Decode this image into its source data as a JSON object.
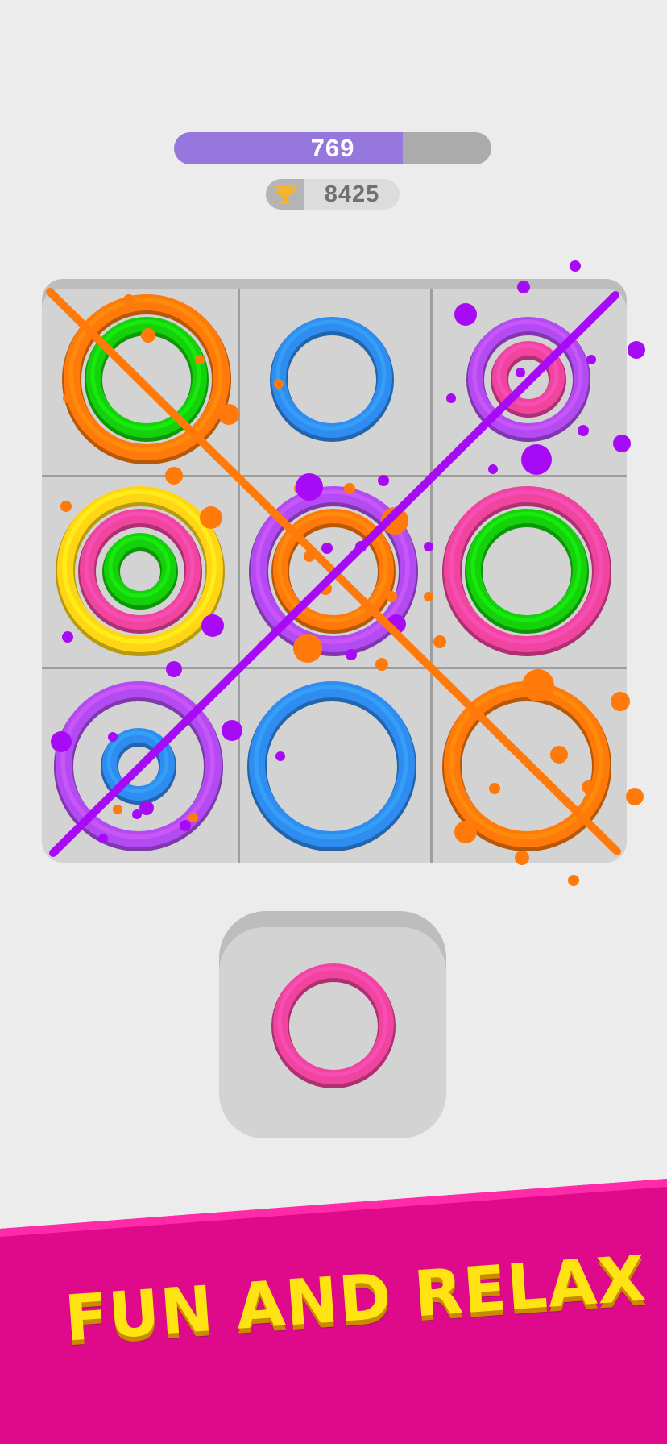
{
  "hud": {
    "score": "769",
    "score_progress": 0.72,
    "best_score": "8425"
  },
  "icons": {
    "best": "trophy-icon"
  },
  "colors": {
    "orange": "#ff7a0a",
    "green": "#14d10c",
    "blue": "#2f8cf0",
    "purple": "#b24cf2",
    "pink": "#f0449e",
    "yellow": "#ffd616",
    "splat_purple": "#a70bf5",
    "banner": "#de0a8b",
    "banner_text": "#ffe312"
  },
  "board": {
    "cells": [
      {
        "rings": [
          {
            "size": "large",
            "color": "orange"
          },
          {
            "size": "medium",
            "color": "green"
          }
        ]
      },
      {
        "rings": [
          {
            "size": "medium",
            "color": "blue"
          }
        ]
      },
      {
        "rings": [
          {
            "size": "medium",
            "color": "purple"
          },
          {
            "size": "small",
            "color": "pink"
          }
        ]
      },
      {
        "rings": [
          {
            "size": "large",
            "color": "yellow"
          },
          {
            "size": "medium",
            "color": "pink"
          },
          {
            "size": "small",
            "color": "green"
          }
        ]
      },
      {
        "rings": [
          {
            "size": "large",
            "color": "purple"
          },
          {
            "size": "medium",
            "color": "orange"
          }
        ]
      },
      {
        "rings": [
          {
            "size": "large",
            "color": "pink"
          },
          {
            "size": "medium",
            "color": "green"
          }
        ]
      },
      {
        "rings": [
          {
            "size": "large",
            "color": "purple"
          },
          {
            "size": "small",
            "color": "blue"
          }
        ]
      },
      {
        "rings": [
          {
            "size": "large",
            "color": "blue"
          }
        ]
      },
      {
        "rings": [
          {
            "size": "large",
            "color": "orange"
          }
        ]
      }
    ],
    "winning_lines": [
      {
        "color": "orange",
        "direction": "diagonal-down"
      },
      {
        "color": "splat_purple",
        "direction": "diagonal-up"
      }
    ]
  },
  "tray": {
    "next_piece": {
      "size": "medium",
      "color": "pink"
    }
  },
  "banner": {
    "text": "FUN AND RELAX"
  }
}
